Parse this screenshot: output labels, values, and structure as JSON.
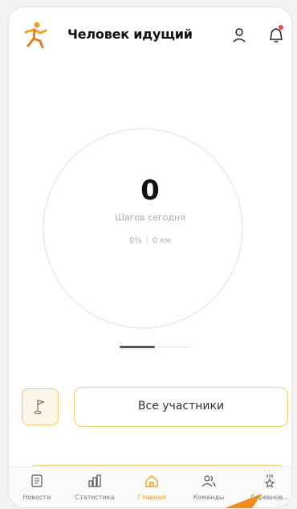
{
  "header": {
    "title": "Человек идущий"
  },
  "icons": {
    "logo": "running-man-logo",
    "profile": "profile-icon",
    "notifications": "bell-icon"
  },
  "colors": {
    "accent": "#f0a020",
    "border_accent": "#f0c96a",
    "notification_dot": "#e94b3c"
  },
  "steps": {
    "value": "0",
    "caption": "Шагов сегодня",
    "percent": "0%",
    "distance": "0 км"
  },
  "actions": {
    "all_participants": "Все участники"
  },
  "bottom_nav": {
    "items": [
      {
        "label": "Новости",
        "icon": "news-icon"
      },
      {
        "label": "Статистика",
        "icon": "stats-icon"
      },
      {
        "label": "Главная",
        "icon": "home-icon",
        "active": true
      },
      {
        "label": "Команды",
        "icon": "teams-icon"
      },
      {
        "label": "Соревнов...",
        "icon": "competitions-icon"
      }
    ]
  }
}
